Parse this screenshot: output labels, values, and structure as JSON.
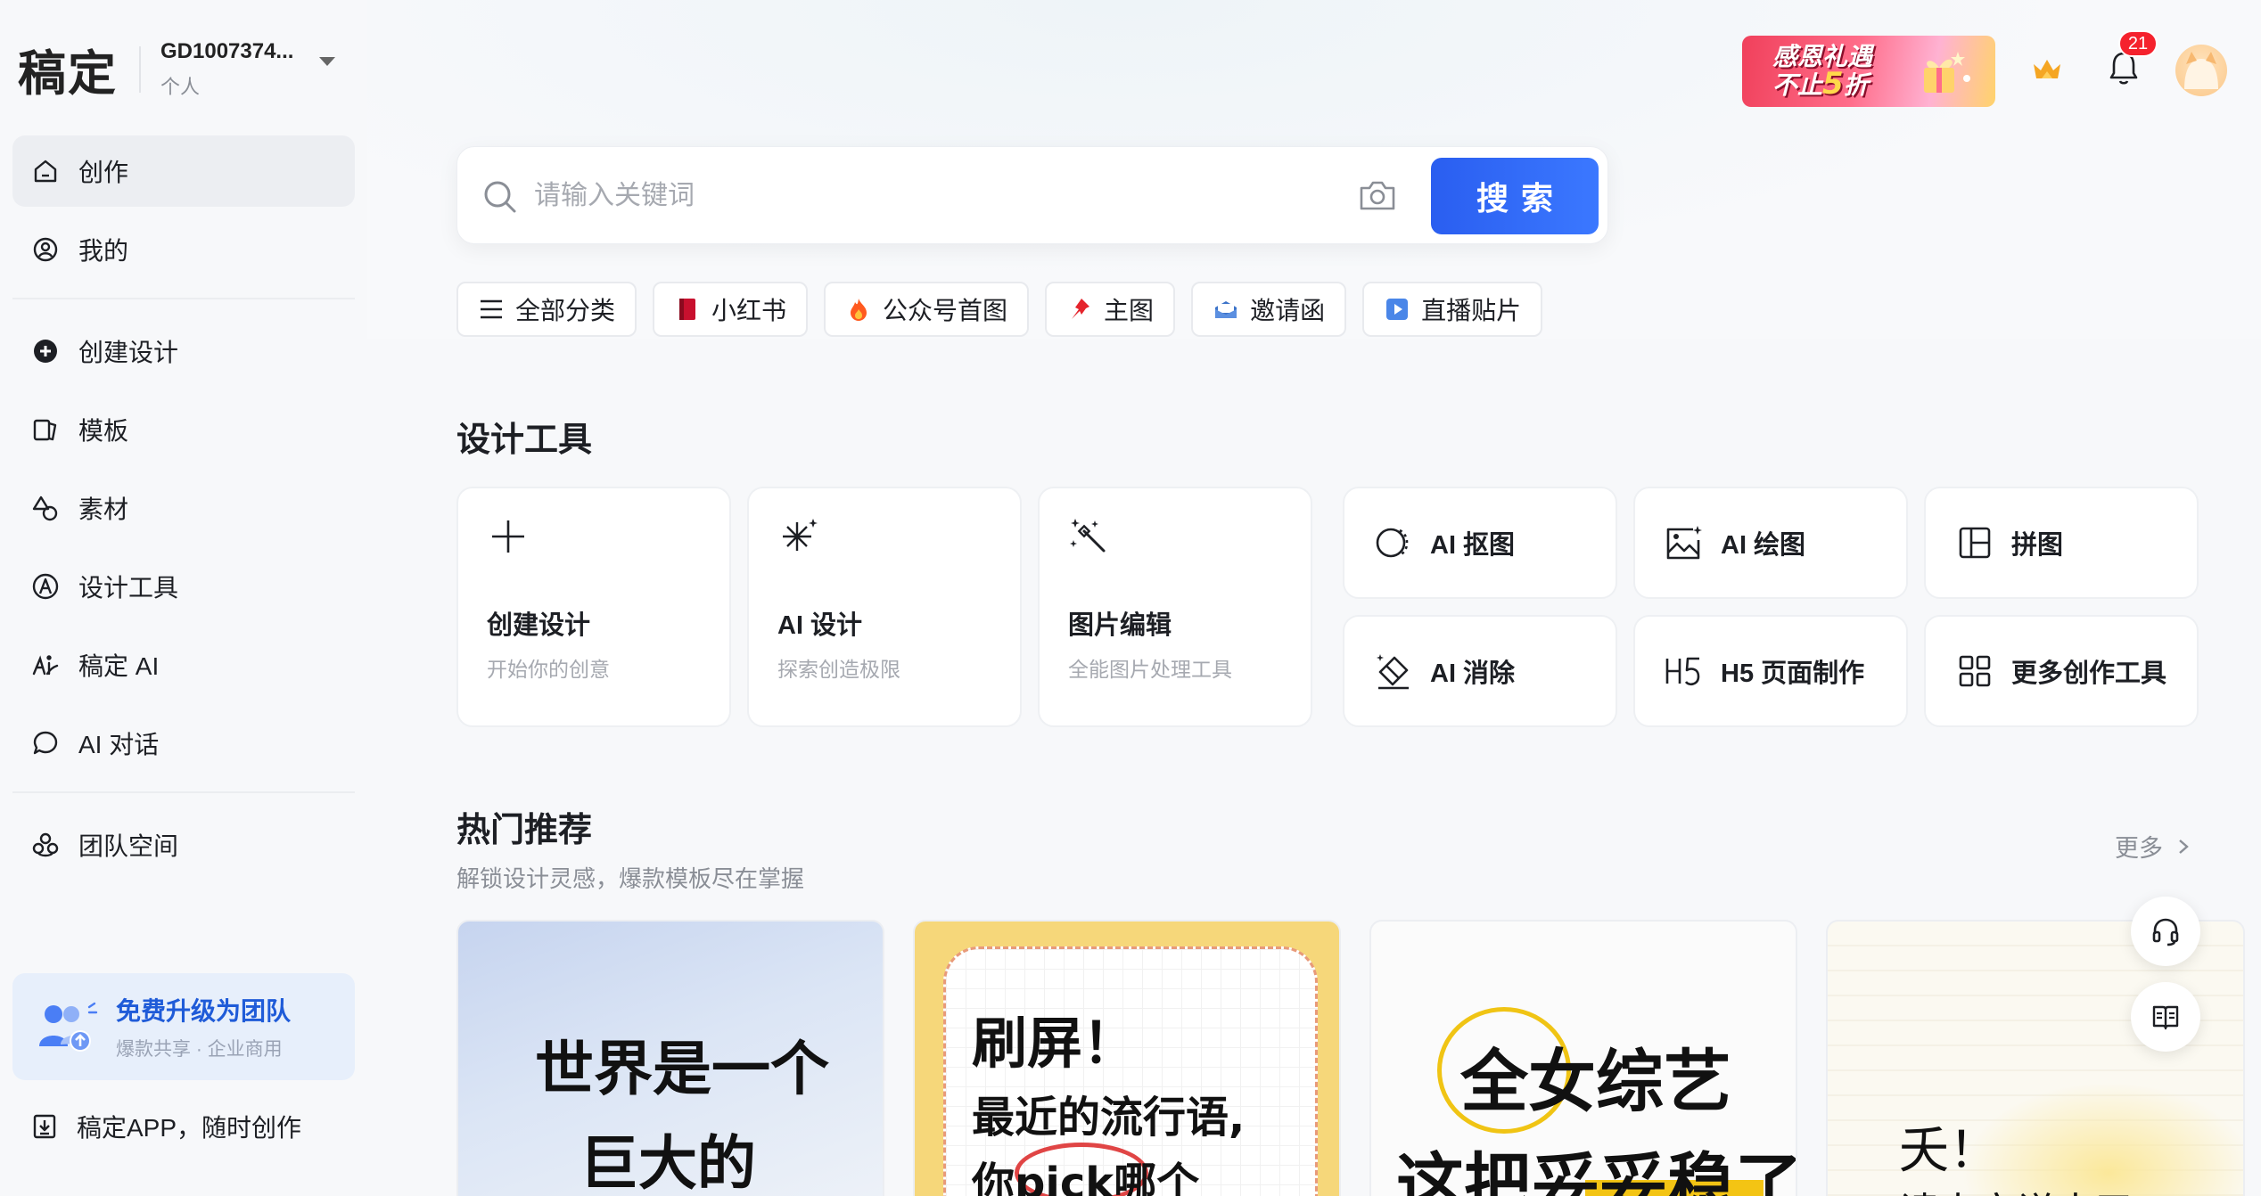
{
  "brand": {
    "logo": "稿定",
    "account_id": "GD1007374...",
    "account_type": "个人"
  },
  "sidebar": {
    "items": [
      {
        "label": "创作",
        "icon": "home-icon"
      },
      {
        "label": "我的",
        "icon": "user-circle-icon"
      },
      {
        "label": "创建设计",
        "icon": "plus-circle-icon"
      },
      {
        "label": "模板",
        "icon": "template-icon"
      },
      {
        "label": "素材",
        "icon": "shapes-icon"
      },
      {
        "label": "设计工具",
        "icon": "pen-nib-icon"
      },
      {
        "label": "稿定 AI",
        "icon": "ai-icon"
      },
      {
        "label": "AI 对话",
        "icon": "chat-bubble-icon"
      },
      {
        "label": "团队空间",
        "icon": "team-icon"
      }
    ],
    "upgrade": {
      "title": "免费升级为团队",
      "subtitle": "爆款共享 · 企业商用"
    },
    "app_link": "稿定APP，随时创作"
  },
  "topbar": {
    "promo_line1": "感恩礼遇",
    "promo_line2_a": "不止",
    "promo_line2_num": "5",
    "promo_line2_b": "折",
    "notification_count": "21"
  },
  "search": {
    "placeholder": "请输入关键词",
    "button_label": "搜索"
  },
  "chips": [
    {
      "label": "全部分类",
      "icon": "menu-icon"
    },
    {
      "label": "小红书",
      "icon": "red-book-icon"
    },
    {
      "label": "公众号首图",
      "icon": "fire-icon"
    },
    {
      "label": "主图",
      "icon": "pushpin-icon"
    },
    {
      "label": "邀请函",
      "icon": "envelope-icon"
    },
    {
      "label": "直播贴片",
      "icon": "play-icon"
    }
  ],
  "design_tools": {
    "title": "设计工具",
    "big": [
      {
        "name": "创建设计",
        "desc": "开始你的创意",
        "icon": "plus-icon"
      },
      {
        "name": "AI 设计",
        "desc": "探索创造极限",
        "icon": "sparkle-icon"
      },
      {
        "name": "图片编辑",
        "desc": "全能图片处理工具",
        "icon": "magic-wand-icon"
      }
    ],
    "small": [
      {
        "name": "AI 抠图",
        "icon": "cutout-icon"
      },
      {
        "name": "AI 绘图",
        "icon": "image-draw-icon"
      },
      {
        "name": "拼图",
        "icon": "collage-icon"
      },
      {
        "name": "AI 消除",
        "icon": "eraser-icon"
      },
      {
        "name": "H5 页面制作",
        "icon": "h5-icon"
      },
      {
        "name": "更多创作工具",
        "icon": "grid-icon"
      }
    ]
  },
  "hot": {
    "title": "热门推荐",
    "subtitle": "解锁设计灵感，爆款模板尽在掌握",
    "more_label": "更多",
    "cards": [
      {
        "line1": "世界是一个",
        "line2": "巨大的"
      },
      {
        "line1": "刷屏！",
        "line2": "最近的流行语,",
        "line3": "你pick哪个"
      },
      {
        "line1": "全女综艺",
        "line2": "这把妥妥稳了"
      },
      {
        "line1": "夭！",
        "line2": "请大家说出了?"
      }
    ]
  },
  "colors": {
    "primary": "#2a5ef0",
    "badge": "#f5222d",
    "upgrade_text": "#1f5bd8",
    "active_nav_bg": "#eceef2"
  }
}
